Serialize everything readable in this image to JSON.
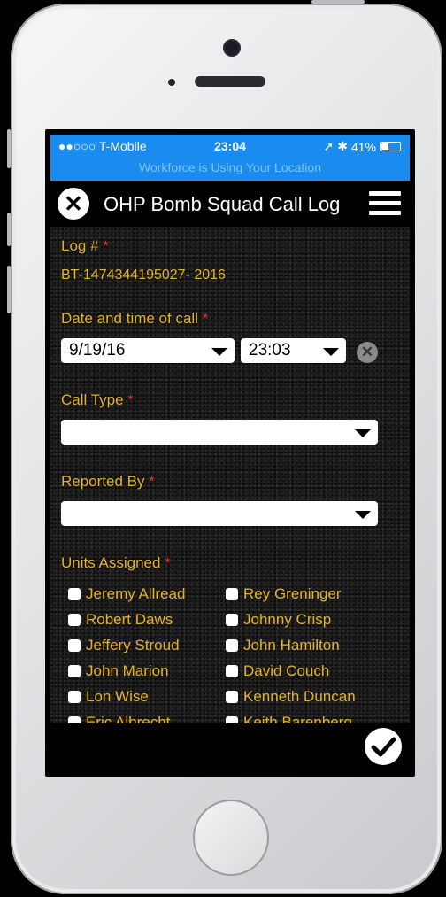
{
  "status_bar": {
    "carrier": "●●○○○ T-Mobile",
    "time": "23:04",
    "battery": "41%",
    "banner": "Workforce is Using Your Location"
  },
  "navbar": {
    "title": "OHP Bomb Squad Call Log",
    "close_icon": "close-icon",
    "menu_icon": "hamburger-menu-icon"
  },
  "form": {
    "log_label": "Log #",
    "log_value": "BT-1474344195027- 2016",
    "date_label": "Date and time of call",
    "date_value": "9/19/16",
    "time_value": "23:03",
    "call_type_label": "Call Type",
    "call_type_value": "",
    "reported_by_label": "Reported By",
    "reported_by_value": "",
    "units_label": "Units Assigned",
    "required_mark": "*",
    "units": [
      "Jeremy Allread",
      "Rey Greninger",
      "Robert Daws",
      "Johnny Crisp",
      "Jeffery Stroud",
      "John Hamilton",
      "John Marion",
      "David Couch",
      "Lon Wise",
      "Kenneth Duncan",
      "Eric Albrecht",
      "Keith Barenberg"
    ]
  },
  "colors": {
    "accent_label": "#e5b229",
    "required": "#e8362b",
    "status_bar": "#1a8cf0"
  },
  "bottom": {
    "submit_icon": "checkmark-icon"
  }
}
